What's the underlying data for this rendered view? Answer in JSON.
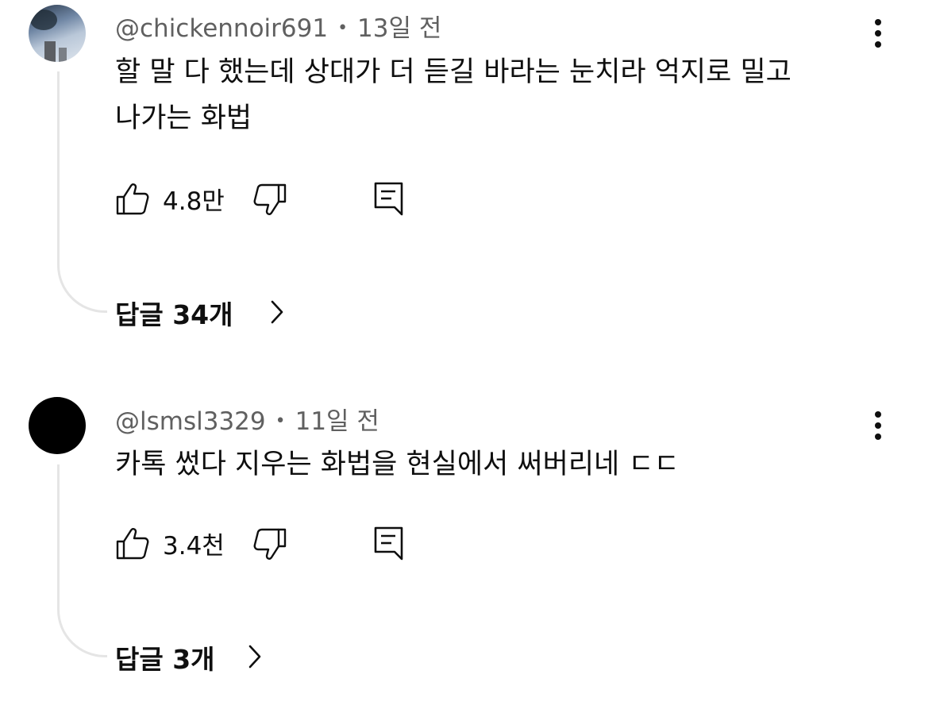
{
  "comments": [
    {
      "author": "@chickennoir691",
      "time": "13일 전",
      "line1": "할 말 다 했는데 상대가 더 듣길 바라는 눈치라 억지로 밀고",
      "line2": "나가는 화법",
      "likes": "4.8만",
      "replies": "답글 34개",
      "avatar": "photo-avatar"
    },
    {
      "author": "@lsmsl3329",
      "time": "11일 전",
      "line1": "카톡 썼다 지우는 화법을 현실에서 써버리네 ㄷㄷ",
      "likes": "3.4천",
      "replies": "답글 3개",
      "avatar": "black-avatar"
    }
  ],
  "separator": "•",
  "icons": [
    "like-icon",
    "dislike-icon",
    "reply-icon",
    "more-options-icon",
    "chevron-right-icon"
  ],
  "colors": {
    "text": "#0f0f0f",
    "meta": "#606060",
    "thread_line": "#e5e5e5",
    "background": "#ffffff"
  }
}
